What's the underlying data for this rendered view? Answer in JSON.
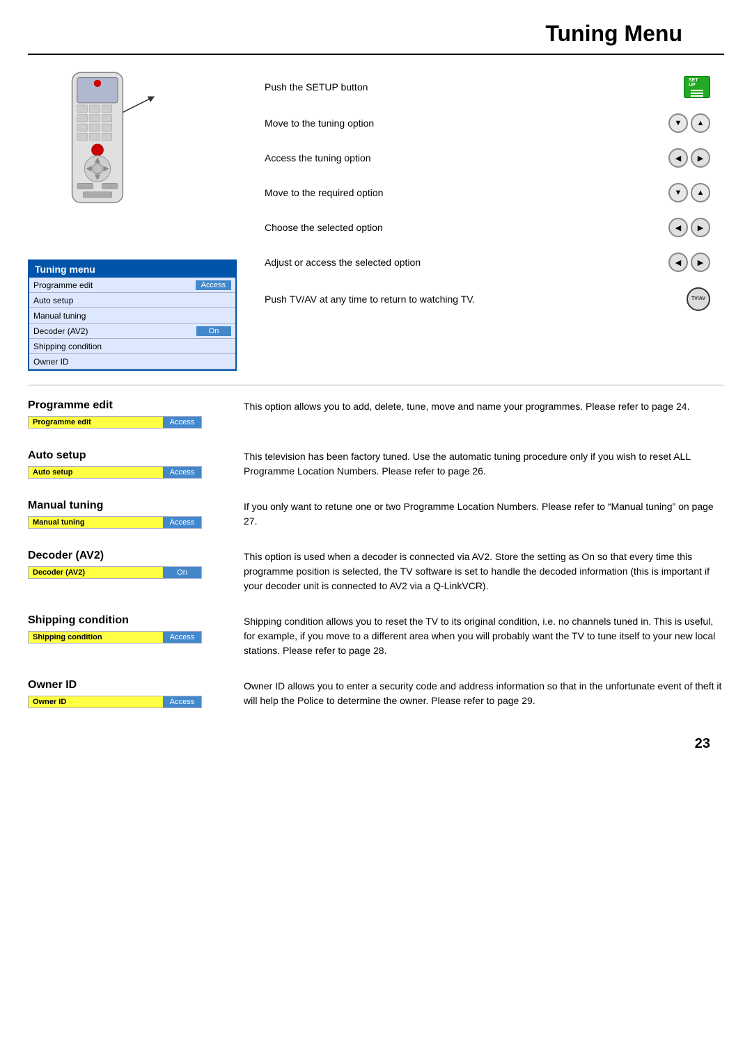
{
  "page": {
    "title": "Tuning  Menu",
    "number": "23"
  },
  "tuning_menu": {
    "header": "Tuning menu",
    "rows": [
      {
        "label": "Programme edit",
        "value": "Access",
        "value_style": "blue"
      },
      {
        "label": "Auto setup",
        "value": "",
        "value_style": "none"
      },
      {
        "label": "Manual tuning",
        "value": "",
        "value_style": "none"
      },
      {
        "label": "Decoder (AV2)",
        "value": "On",
        "value_style": "blue"
      },
      {
        "label": "Shipping condition",
        "value": "",
        "value_style": "none"
      },
      {
        "label": "Owner ID",
        "value": "",
        "value_style": "none"
      }
    ]
  },
  "instructions": [
    {
      "text": "Push the SETUP button",
      "button_type": "setup"
    },
    {
      "text": "Move to the tuning option",
      "button_type": "up_down"
    },
    {
      "text": "Access the tuning option",
      "button_type": "left_right"
    },
    {
      "text": "Move to the required option",
      "button_type": "up_down"
    },
    {
      "text": "Choose the selected option",
      "button_type": "left_right"
    },
    {
      "text": "Adjust or access the selected option",
      "button_type": "left_right"
    },
    {
      "text": "Push TV/AV at any time to return to watching TV.",
      "button_type": "tv_av"
    }
  ],
  "menu_items": [
    {
      "title": "Programme edit",
      "bar_label": "Programme edit",
      "bar_value": "Access",
      "description": "This option allows you to add, delete, tune, move and name your programmes. Please refer to page 24."
    },
    {
      "title": "Auto setup",
      "bar_label": "Auto setup",
      "bar_value": "Access",
      "description": "This television has been factory tuned. Use the automatic tuning procedure only if you wish to reset ALL Programme Location Numbers. Please refer to page 26."
    },
    {
      "title": "Manual tuning",
      "bar_label": "Manual tuning",
      "bar_value": "Access",
      "description": "If you only want to retune one or two Programme Location Numbers. Please refer to “Manual tuning” on page 27."
    },
    {
      "title": "Decoder (AV2)",
      "bar_label": "Decoder (AV2)",
      "bar_value": "On",
      "description": "This option is used when a decoder is connected via AV2. Store the setting as On so that every time this programme position is selected, the TV software is set to handle the decoded information (this is important if your decoder unit is connected to AV2 via a Q-LinkVCR)."
    },
    {
      "title": "Shipping condition",
      "bar_label": "Shipping condition",
      "bar_value": "Access",
      "description": "Shipping condition allows you to reset the TV to its original condition, i.e. no channels tuned in. This is useful, for example, if you move to a different area when you will probably want the TV to tune itself to your new local stations. Please refer to page 28."
    },
    {
      "title": "Owner ID",
      "bar_label": "Owner ID",
      "bar_value": "Access",
      "description": "Owner ID allows you to enter a security code and address information so that in the unfortunate event of theft it will help the Police to determine the owner. Please refer to page 29."
    }
  ]
}
